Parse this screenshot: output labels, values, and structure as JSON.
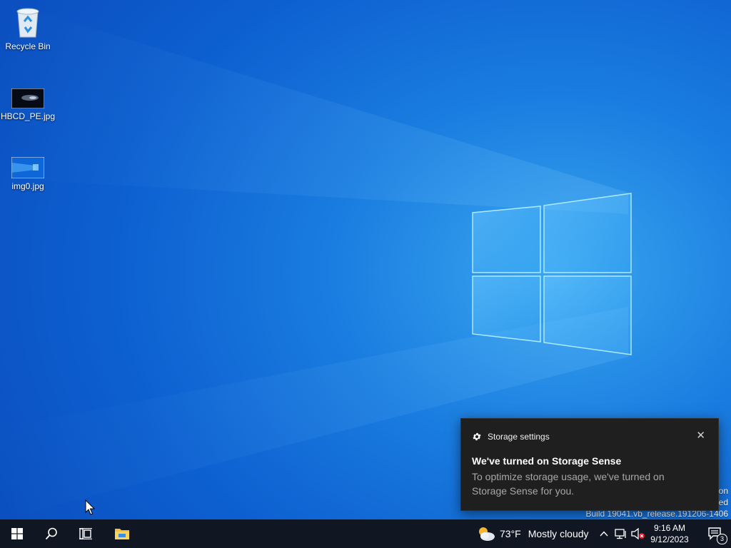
{
  "desktop": {
    "icons": [
      {
        "label": "Recycle Bin",
        "icon": "recycle-bin-icon"
      },
      {
        "label": "HBCD_PE.jpg",
        "icon": "image-file-icon"
      },
      {
        "label": "img0.jpg",
        "icon": "image-file-icon"
      }
    ],
    "watermark": {
      "line1": "on",
      "line2": "ed",
      "line3": "Build 19041.vb_release.191206-1406"
    }
  },
  "notification": {
    "app_name": "Storage settings",
    "app_icon": "gear-icon",
    "title": "We've turned on Storage Sense",
    "body": "To optimize storage usage, we've turned on Storage Sense for you.",
    "close_icon": "close-icon"
  },
  "taskbar": {
    "start_icon": "windows-logo-icon",
    "search_icon": "search-icon",
    "task_view_icon": "task-view-icon",
    "pinned_app_icon": "file-explorer-icon",
    "weather": {
      "icon": "partly-cloudy-icon",
      "temperature": "73°F",
      "condition": "Mostly cloudy"
    },
    "tray": {
      "chevron_icon": "chevron-up-icon",
      "network_icon": "network-icon",
      "volume_icon": "volume-muted-icon"
    },
    "clock": {
      "time": "9:16 AM",
      "date": "9/12/2023"
    },
    "action_center": {
      "icon": "notification-icon",
      "badge": "3"
    }
  },
  "colors": {
    "accent": "#0b78d8",
    "taskbar": "#111722",
    "toast_bg": "#1f1f1f"
  }
}
